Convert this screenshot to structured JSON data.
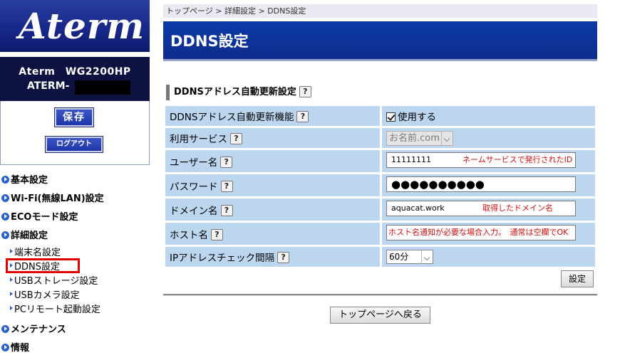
{
  "sidebar": {
    "logo": "Aterm",
    "model_line1": "Aterm　WG2200HP",
    "model_line2": "ATERM-",
    "save_label": "保存",
    "logout_label": "ログアウト",
    "nav": [
      {
        "label": "基本設定"
      },
      {
        "label": "Wi-Fi(無線LAN)設定"
      },
      {
        "label": "ECOモード設定"
      },
      {
        "label": "詳細設定"
      }
    ],
    "sub_items": [
      {
        "label": "端末名設定"
      },
      {
        "label": "DDNS設定"
      },
      {
        "label": "USBストレージ設定"
      },
      {
        "label": "USBカメラ設定"
      },
      {
        "label": "PCリモート起動設定"
      }
    ],
    "nav_bottom": [
      {
        "label": "メンテナンス"
      },
      {
        "label": "情報"
      }
    ]
  },
  "breadcrumb": "トップページ > 詳細設定 > DDNS設定",
  "page_title": "DDNS設定",
  "section_title": "DDNSアドレス自動更新設定",
  "help_glyph": "?",
  "form": {
    "auto_update": {
      "label": "DDNSアドレス自動更新機能",
      "checkbox_label": "使用する",
      "checked": true
    },
    "service": {
      "label": "利用サービス",
      "value": "お名前.com"
    },
    "username": {
      "label": "ユーザー名",
      "value": "11111111",
      "annotation": "ネームサービスで発行されたID"
    },
    "password": {
      "label": "パスワード",
      "value": "●●●●●●●●●●"
    },
    "domain": {
      "label": "ドメイン名",
      "value": "aquacat.work",
      "annotation": "取得したドメイン名"
    },
    "host": {
      "label": "ホスト名",
      "annotation": "ホスト名通知が必要な場合入力。　通常は空欄でOK"
    },
    "ip_check": {
      "label": "IPアドレスチェック間隔",
      "value": "60分"
    }
  },
  "buttons": {
    "set_label": "設定",
    "back_top_label": "トップページへ戻る"
  },
  "colors": {
    "header_blue": "#0f2c8c",
    "row_bg": "#bdd6f0",
    "annotation_red": "#d01010",
    "highlight_red": "#e00000"
  }
}
